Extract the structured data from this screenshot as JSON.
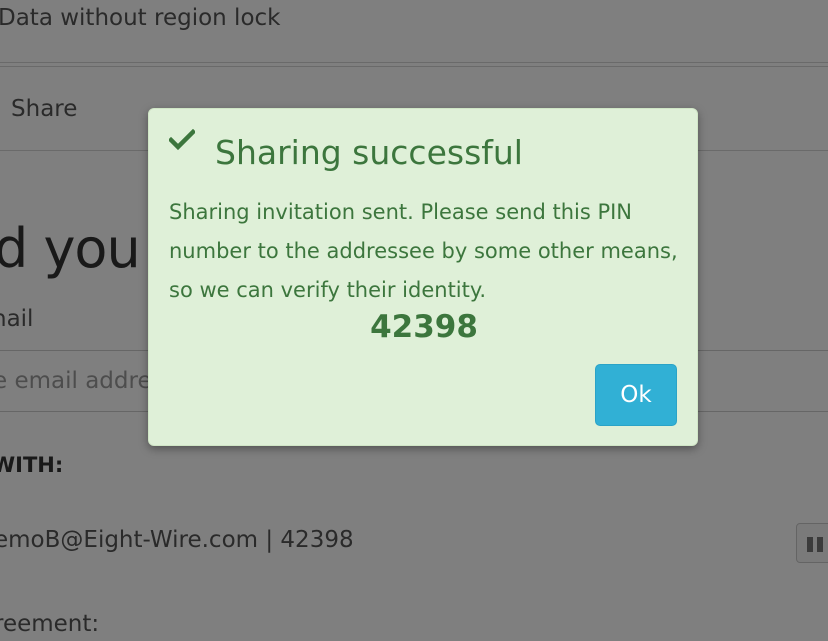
{
  "background": {
    "region_lock_text": "Data without region lock",
    "share_tab_label": "Share",
    "heading": "d you li",
    "email_label": "nail",
    "email_placeholder": "e email addre",
    "shared_with_label": "WITH:",
    "shared_entry": "emoB@Eight-Wire.com | 42398",
    "agreement_label": "reement:"
  },
  "modal": {
    "icon": "check-icon",
    "title": "Sharing successful",
    "message": "Sharing invitation sent. Please send this PIN number to the addressee by some other means, so we can verify their identity.",
    "pin": "42398",
    "ok_label": "Ok",
    "colors": {
      "background": "#dff0d8",
      "text": "#3c763d",
      "button": "#31b0d5"
    }
  }
}
